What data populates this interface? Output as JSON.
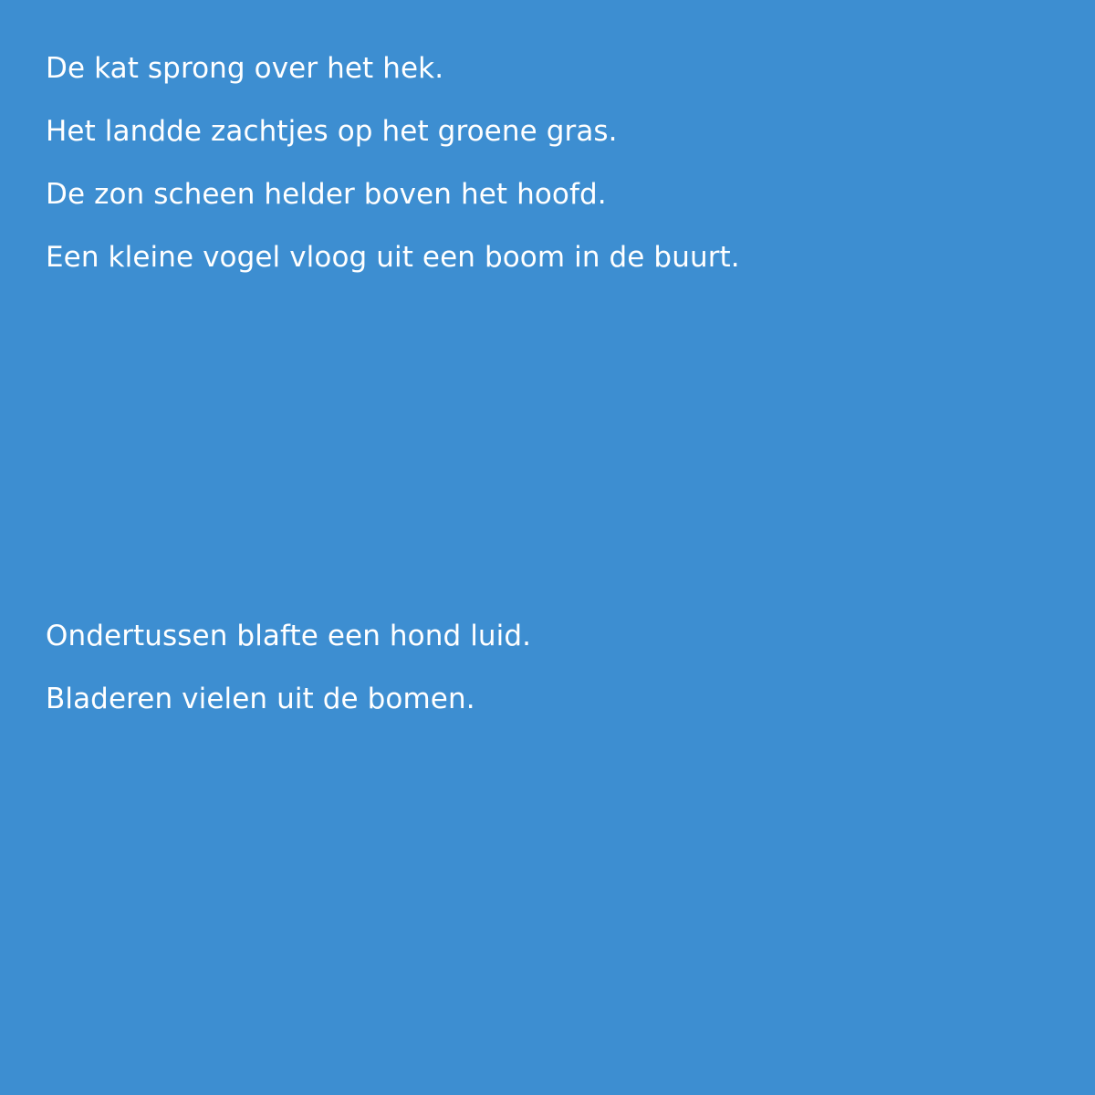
{
  "background_color": "#3d8ed1",
  "text_color": "#ffffff",
  "paragraphs": [
    {
      "lines": [
        "De kat sprong over het hek.",
        "Het landde zachtjes op het groene gras.",
        "De zon scheen helder boven het hoofd.",
        "Een kleine vogel vloog uit een boom in de buurt."
      ]
    },
    {
      "lines": [
        "Ondertussen blafte een hond luid.",
        "Bladeren vielen uit de bomen."
      ]
    }
  ]
}
